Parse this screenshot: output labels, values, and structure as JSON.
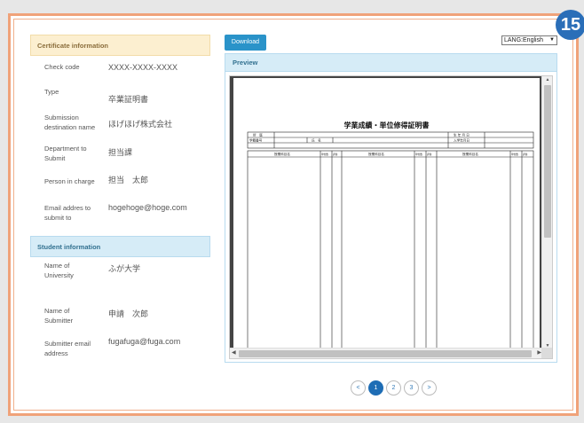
{
  "step_badge": "15",
  "certificate_section": {
    "title": "Certificate information",
    "rows": [
      {
        "label": "Check code",
        "value": "XXXX-XXXX-XXXX"
      },
      {
        "label": "Type",
        "value": "卒業証明書"
      },
      {
        "label": "Submission destination name",
        "value": "ほげほげ株式会社"
      },
      {
        "label": "Department to Submit",
        "value": "担当課"
      },
      {
        "label": "Person in charge",
        "value": "担当　太郎"
      },
      {
        "label": "Email addres to submit to",
        "value": "hogehoge@hoge.com"
      }
    ]
  },
  "student_section": {
    "title": "Student information",
    "rows": [
      {
        "label": "Name of University",
        "value": "ふが大学"
      },
      {
        "label": "Name of Submitter",
        "value": "申請　次郎"
      },
      {
        "label": "Submitter email address",
        "value": "fugafuga@fuga.com"
      }
    ]
  },
  "toolbar": {
    "download_label": "Download",
    "language_value": "LANG:English"
  },
  "preview": {
    "title": "Preview",
    "document": {
      "title": "学業成績・単位修得証明書",
      "field_affiliation": "所　属",
      "field_birthdate": "生 年 月 日",
      "field_student_id": "学籍番号",
      "field_name": "氏　名",
      "field_enroll_date": "入学年月日",
      "col_subject": "授業科目名",
      "col_credits": "単位数",
      "col_grade": "評価"
    }
  },
  "pagination": {
    "prev": "<",
    "pages": [
      "1",
      "2",
      "3"
    ],
    "next": ">",
    "current": "1"
  }
}
